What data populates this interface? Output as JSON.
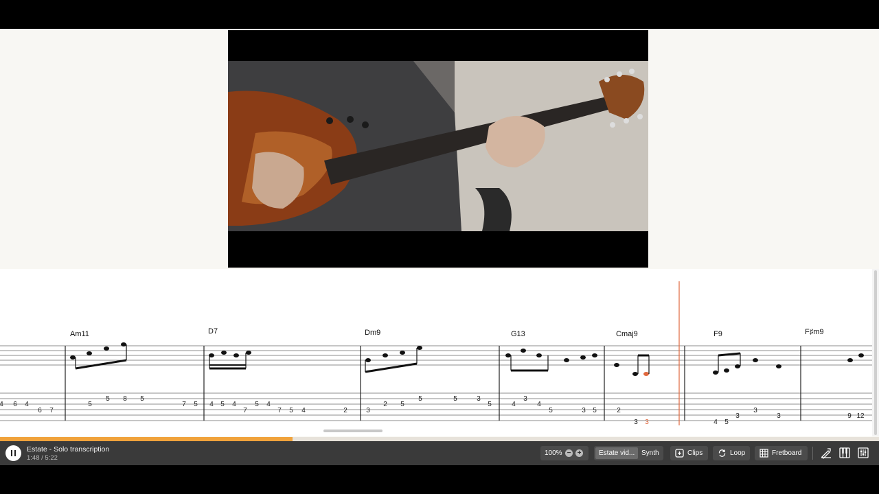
{
  "player": {
    "title": "Estate - Solo transcription",
    "time": "1:48 / 5:22",
    "progress_fraction": 0.333
  },
  "toolbar": {
    "zoom": "100%",
    "source_active": "Estate vid...",
    "source_alt": "Synth",
    "clips": "Clips",
    "loop": "Loop",
    "fretboard": "Fretboard"
  },
  "icons": [
    "pause-icon",
    "minus-icon",
    "plus-icon",
    "clips-icon",
    "loop-icon",
    "fretboard-icon",
    "tuner-icon",
    "piano-icon",
    "mixer-icon"
  ],
  "score": {
    "chords": [
      "Am11",
      "D7",
      "Dm9",
      "G13",
      "Cmaj9",
      "F9",
      "F♯m9"
    ],
    "tab_rows": [
      [
        "4",
        "6",
        "4",
        "6",
        "7",
        "5",
        "5",
        "8",
        "5",
        "7",
        "5"
      ],
      [
        "4",
        "5",
        "4",
        "7",
        "5",
        "4",
        "7",
        "5",
        "4",
        "2"
      ],
      [
        "3",
        "2",
        "5",
        "5",
        "5",
        "3",
        "5"
      ],
      [
        "4",
        "3",
        "4",
        "5",
        "3",
        "5"
      ],
      [
        "2",
        "3",
        "3",
        "4",
        "5",
        "3",
        "3",
        "3"
      ],
      [
        "9",
        "12"
      ]
    ]
  },
  "colors": {
    "accent": "#f0a23b",
    "playhead": "#e0683e",
    "controls_bg": "#3a3a3a",
    "page_bg": "#f8f7f3"
  }
}
